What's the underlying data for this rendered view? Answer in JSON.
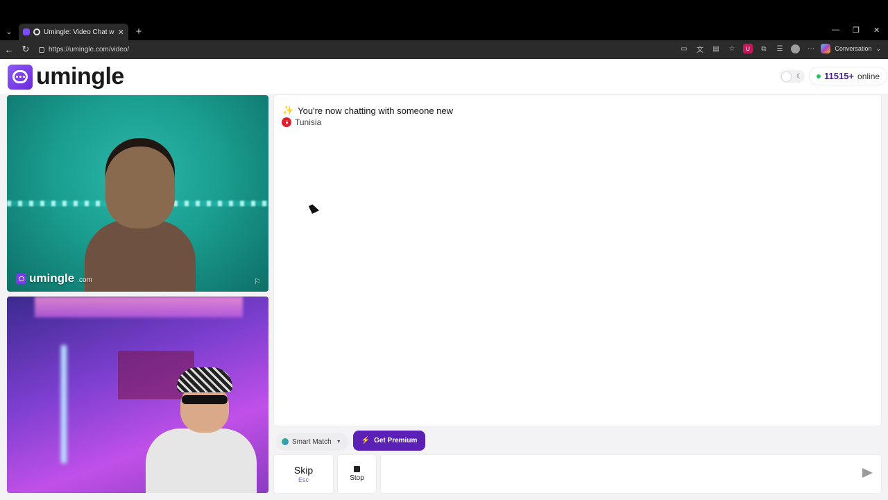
{
  "browser": {
    "tab_title": "Umingle: Video Chat with Stra",
    "tab_close": "✕",
    "new_tab": "+",
    "url": "https://umingle.com/video/",
    "window_controls": [
      "—",
      "❐",
      "✕"
    ],
    "copilot_label": "Conversation"
  },
  "header": {
    "brand": "umingle",
    "online_count": "11515+",
    "online_label": "online",
    "theme_moon": "☾"
  },
  "videos": {
    "watermark_brand": "umingle",
    "watermark_suffix": ".com",
    "report_icon": "⚐"
  },
  "chat": {
    "sparkle": "✨",
    "status_message": "You're now chatting with someone new",
    "country": "Tunisia"
  },
  "controls": {
    "smart_match": "Smart Match",
    "smart_match_caret": "▼",
    "premium": "Get Premium",
    "premium_icon": "⚡",
    "skip": "Skip",
    "skip_key": "Esc",
    "stop": "Stop",
    "message_placeholder": ""
  },
  "colors": {
    "brand": "#6d28d9",
    "premium_bg": "#5b21b6",
    "online_dot": "#22c55e",
    "online_count": "#4c1d95"
  }
}
